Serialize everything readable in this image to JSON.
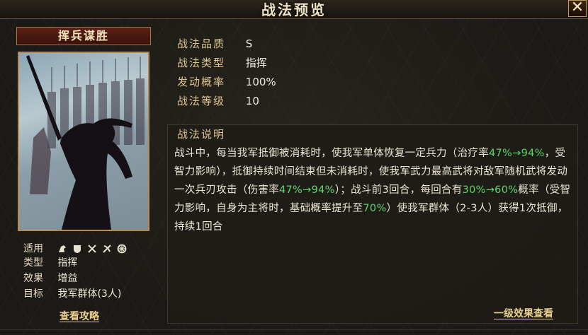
{
  "window": {
    "title": "战法预览"
  },
  "card": {
    "name": "挥兵谋胜",
    "attributes": {
      "applicable_label": "适用",
      "applicable_icons": [
        "cavalry-icon",
        "shield-icon",
        "crossed-spears-icon",
        "bow-icon",
        "chariot-wheel-icon"
      ],
      "type_label": "类型",
      "type_value": "指挥",
      "effect_label": "效果",
      "effect_value": "增益",
      "target_label": "目标",
      "target_value": "我军群体(3人)"
    },
    "guide_link": "查看攻略"
  },
  "info": {
    "quality_label": "战法品质",
    "quality_value": "S",
    "type_label": "战法类型",
    "type_value": "指挥",
    "rate_label": "发动概率",
    "rate_value": "100%",
    "level_label": "战法等级",
    "level_value": "10"
  },
  "description": {
    "title": "战法说明",
    "p1": "战斗中，每当我军抵御被消耗时，使我军单体恢复一定兵力（治疗率",
    "h1": "47%→94%",
    "p2": "，受智力影响），抵御持续时间结束但未消耗时，使我军武力最高武将对敌军随机武将发动一次兵刃攻击（伤害率",
    "h2": "47%→94%",
    "p3": "）；战斗前3回合，每回合有",
    "h3": "30%→60%",
    "p4": "概率（受智力影响，自身为主将时，基础概率提升至",
    "h4": "70%",
    "p5": "）使我军群体（2-3人）获得1次抵御，持续1回合"
  },
  "footer": {
    "level_effect_link": "一级效果查看"
  },
  "colors": {
    "highlight": "#5fd46a",
    "gold": "#dcc48e"
  }
}
